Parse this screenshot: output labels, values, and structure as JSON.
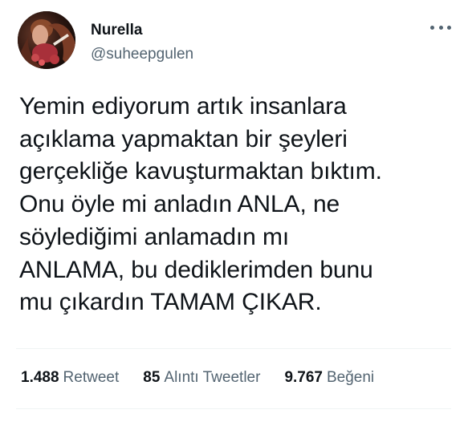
{
  "tweet": {
    "author": {
      "name": "Nurella",
      "handle": "@suheepgulen"
    },
    "text": "Yemin ediyorum artık insanlara\naçıklama yapmaktan bir şeyleri\ngerçekliğe kavuşturmaktan bıktım.\nOnu öyle mi anladın ANLA, ne\nsöylediğimi anlamadın mı\nANLAMA, bu dediklerimden bunu\nmu çıkardın TAMAM ÇIKAR.",
    "stats": {
      "retweets_count": "1.488",
      "retweets_label": "Retweet",
      "quotes_count": "85",
      "quotes_label": "Alıntı Tweetler",
      "likes_count": "9.767",
      "likes_label": "Beğeni"
    },
    "more_icon": "more-horizontal-icon",
    "colors": {
      "text": "#0f1419",
      "secondary": "#536471",
      "divider": "#eff3f4"
    }
  }
}
